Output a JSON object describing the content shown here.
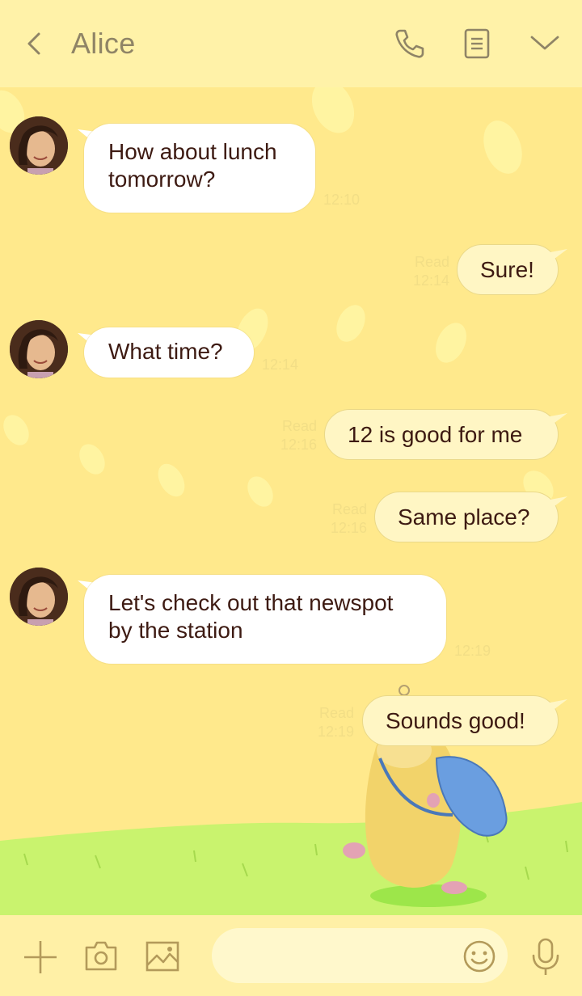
{
  "header": {
    "title": "Alice",
    "icons": [
      "back-icon",
      "phone-icon",
      "notes-icon",
      "chevron-down-icon"
    ]
  },
  "messages": [
    {
      "side": "in",
      "lines": [
        "How about lunch",
        "tomorrow?"
      ],
      "time": "12:10"
    },
    {
      "side": "out",
      "lines": [
        "Sure!"
      ],
      "read": "Read",
      "time": "12:14"
    },
    {
      "side": "in",
      "lines": [
        "What time?"
      ],
      "time": "12:14"
    },
    {
      "side": "out",
      "lines": [
        "12 is good for me"
      ],
      "read": "Read",
      "time": "12:16"
    },
    {
      "side": "out",
      "lines": [
        "Same place?"
      ],
      "read": "Read",
      "time": "12:16"
    },
    {
      "side": "in",
      "lines": [
        "Let's check out that newspot",
        "by the station"
      ],
      "time": "12:19"
    },
    {
      "side": "out",
      "lines": [
        "Sounds good!"
      ],
      "read": "Read",
      "time": "12:19"
    }
  ],
  "inputbar": {
    "placeholder": "",
    "icons": [
      "plus-icon",
      "camera-icon",
      "image-icon",
      "emoji-icon",
      "microphone-icon"
    ]
  },
  "colors": {
    "header_bg": "#fff2a8",
    "chat_bg": "#ffe98c",
    "grass": "#c9f36e",
    "incoming_bubble": "#ffffff",
    "outgoing_bubble": "#fff6c4",
    "message_text": "#3d1a12",
    "meta_text": "#f2de86"
  }
}
